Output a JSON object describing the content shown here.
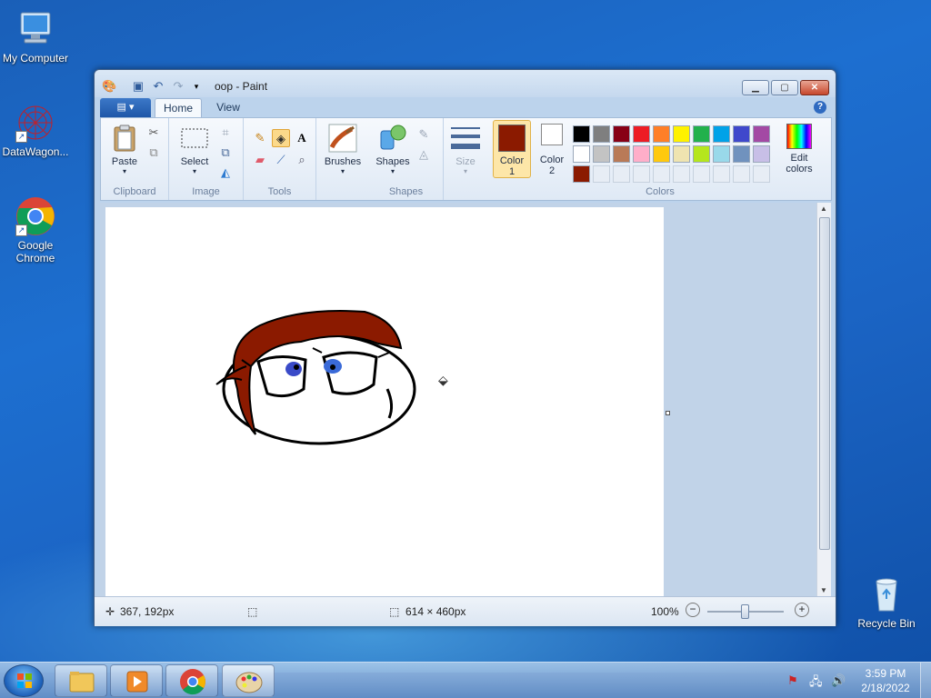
{
  "desktop": {
    "icons": [
      {
        "label": "My Computer"
      },
      {
        "label": "DataWagon..."
      },
      {
        "label": "Google Chrome"
      },
      {
        "label": "Recycle Bin"
      }
    ]
  },
  "window": {
    "title": "oop - Paint",
    "file_tab_glyph": "▤ ▾",
    "tabs": [
      {
        "label": "Home",
        "active": true
      },
      {
        "label": "View",
        "active": false
      }
    ],
    "help_glyph": "?"
  },
  "ribbon": {
    "groups": {
      "clipboard": "Clipboard",
      "image": "Image",
      "tools": "Tools",
      "shapes": "Shapes",
      "colors": "Colors"
    },
    "buttons": {
      "paste": "Paste",
      "select": "Select",
      "brushes": "Brushes",
      "shapes": "Shapes",
      "size": "Size",
      "color1_line1": "Color",
      "color1_line2": "1",
      "color2_line1": "Color",
      "color2_line2": "2",
      "edit_colors_line1": "Edit",
      "edit_colors_line2": "colors"
    },
    "color1": "#8b1a00",
    "color2": "#ffffff",
    "palette_row1": [
      "#000000",
      "#7f7f7f",
      "#880015",
      "#ed1c24",
      "#ff7f27",
      "#fff200",
      "#22b14c",
      "#00a2e8",
      "#3f48cc",
      "#a349a4"
    ],
    "palette_row2": [
      "#ffffff",
      "#c3c3c3",
      "#b97a57",
      "#ffaec9",
      "#ffc90e",
      "#efe4b0",
      "#b5e61d",
      "#99d9ea",
      "#7092be",
      "#c8bfe7"
    ],
    "custom_colors": [
      "#8b1a00"
    ]
  },
  "status": {
    "cursor_pos": "367, 192px",
    "canvas_size": "614 × 460px",
    "zoom": "100%"
  },
  "taskbar": {
    "time": "3:59 PM",
    "date": "2/18/2022"
  }
}
